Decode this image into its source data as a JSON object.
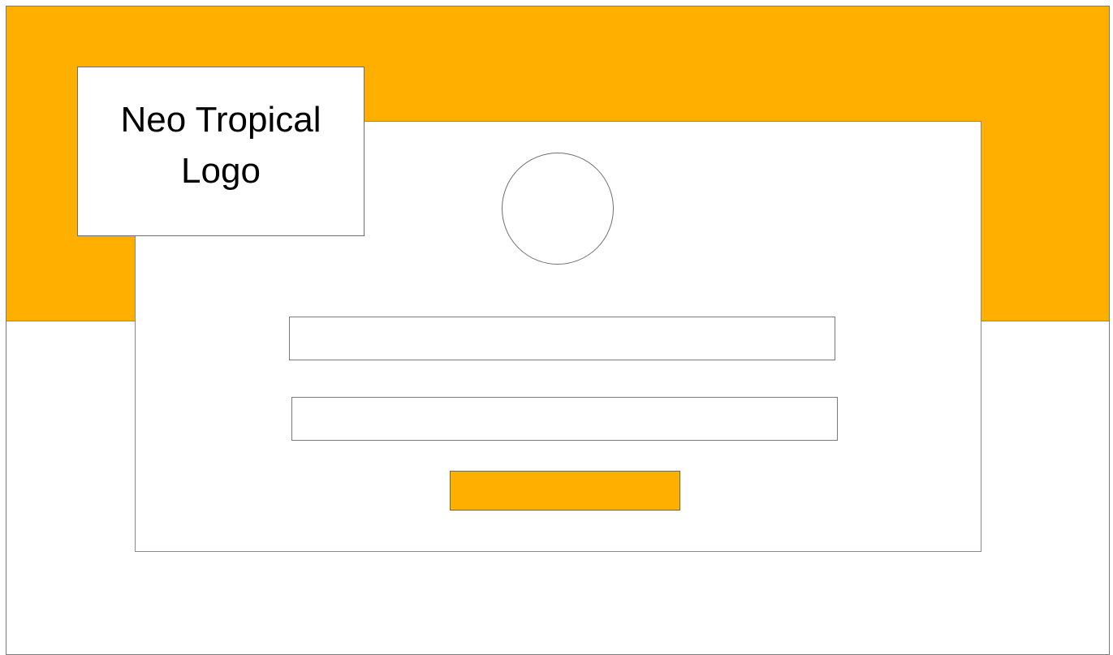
{
  "theme": {
    "accent_color": "#FFAF00",
    "background_color": "#FFFFFF",
    "border_color": "#7A7A7A"
  },
  "logo": {
    "text": "Neo Tropical\nLogo"
  },
  "form": {
    "field_1": {
      "value": "",
      "placeholder": ""
    },
    "field_2": {
      "value": "",
      "placeholder": ""
    },
    "submit_label": ""
  }
}
